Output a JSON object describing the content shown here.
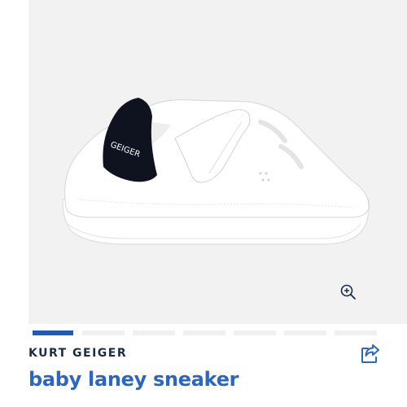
{
  "gallery": {
    "image_subject": "white baby sneaker with black heel tab",
    "heel_tab_text": "GEIGER",
    "total_slides": 7,
    "active_slide": 1,
    "zoom_icon": "zoom-in-icon",
    "background": "#f2f2f2"
  },
  "product": {
    "brand": "KURT GEIGER",
    "title": "baby laney sneaker",
    "share_icon": "share-icon"
  },
  "colors": {
    "accent": "#2a66c2",
    "brand_text": "#1c2b4a",
    "pager_active": "#1e5bb8",
    "pager_inactive": "#f0f0f0"
  }
}
